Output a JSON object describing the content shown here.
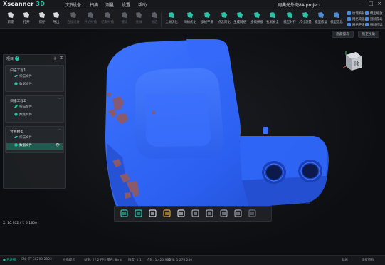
{
  "app": {
    "brand": "Xscanner 3D",
    "brand_main": "Xscanner",
    "brand_accent": " 3D",
    "project_title": "词典光外壳8A.project"
  },
  "menu": [
    "文件",
    "设备",
    "扫描",
    "测量",
    "设置",
    "帮助"
  ],
  "toolbar": {
    "buttons": [
      {
        "label": "新建",
        "icon": "new-icon",
        "enabled": true
      },
      {
        "label": "打开",
        "icon": "open-icon",
        "enabled": true
      },
      {
        "label": "保存",
        "icon": "save-icon",
        "enabled": true
      },
      {
        "label": "导出",
        "icon": "export-icon",
        "enabled": true
      },
      {
        "label": "连接设备",
        "icon": "connect-icon",
        "enabled": false
      },
      {
        "label": "开始扫描",
        "icon": "scan-icon",
        "enabled": false
      },
      {
        "label": "结束扫描",
        "icon": "stop-icon",
        "enabled": false
      },
      {
        "label": "撤销",
        "icon": "undo-icon",
        "enabled": false
      },
      {
        "label": "重做",
        "icon": "redo-icon",
        "enabled": false
      },
      {
        "label": "框选",
        "icon": "select-icon",
        "enabled": false
      },
      {
        "label": "全局优化",
        "icon": "optimize-icon",
        "enabled": true
      },
      {
        "label": "网格优化",
        "icon": "mesh-optimize-icon",
        "enabled": true
      },
      {
        "label": "多帧平滑",
        "icon": "smooth-icon",
        "enabled": true
      },
      {
        "label": "点云简化",
        "icon": "simplify-icon",
        "enabled": true
      },
      {
        "label": "生成网格",
        "icon": "mesh-icon",
        "enabled": true
      },
      {
        "label": "多帧拼接",
        "icon": "merge-icon",
        "enabled": true
      },
      {
        "label": "孔洞补全",
        "icon": "hole-fill-icon",
        "enabled": true
      },
      {
        "label": "模型对齐",
        "icon": "align-icon",
        "enabled": true
      },
      {
        "label": "尺寸测量",
        "icon": "measure-icon",
        "enabled": true
      },
      {
        "label": "模型修复",
        "icon": "repair-icon",
        "enabled": true
      },
      {
        "label": "模型信息",
        "icon": "info-icon",
        "enabled": true
      }
    ],
    "mini": [
      {
        "label": "纹理映射"
      },
      {
        "label": "网格简化"
      },
      {
        "label": "网格平滑"
      },
      {
        "label": "模型缩放"
      },
      {
        "label": "删除孤岛"
      },
      {
        "label": "删除所选"
      }
    ]
  },
  "sub_actions": [
    "隐藏孤岛",
    "锁定视角"
  ],
  "tree": {
    "title": "项目",
    "count": "3",
    "groups": [
      {
        "name": "扫描工程1",
        "rows": [
          "扫描文件",
          "数据文件"
        ]
      },
      {
        "name": "扫描工程2",
        "rows": [
          "扫描文件",
          "数据文件"
        ]
      },
      {
        "name": "合并模型",
        "rows": [
          "扫描文件",
          "数据文件"
        ],
        "selected_row": 1
      }
    ]
  },
  "view_cube": {
    "face": "顶"
  },
  "bottom_tools": [
    "point-cloud-icon",
    "mesh-display-icon",
    "cube-icon",
    "rotate-icon",
    "lighting-icon",
    "front-view-icon",
    "side-view-icon",
    "top-view-icon",
    "iso-view-icon",
    "reset-view-icon"
  ],
  "coords": "X: 10.902 / Y: 5.1800",
  "status": [
    {
      "text": "● 已连接",
      "ok": true
    },
    {
      "text": "SN: ZT-SC200-2023"
    },
    {
      "text": "扫描模式"
    },
    {
      "text": "帧率: 27.2 FPS"
    },
    {
      "text": "曝光: 8ms"
    },
    {
      "text": "精度: 0.1"
    },
    {
      "text": "点数: 1,423,980"
    },
    {
      "text": "面数: 1,278,240"
    },
    {
      "text": "就绪"
    },
    {
      "text": "版权所有"
    }
  ],
  "colors": {
    "model": "#2d63ee",
    "model_highlight": "#6f96ff",
    "defect": "#8a5a6a",
    "accent": "#27c3a7"
  }
}
